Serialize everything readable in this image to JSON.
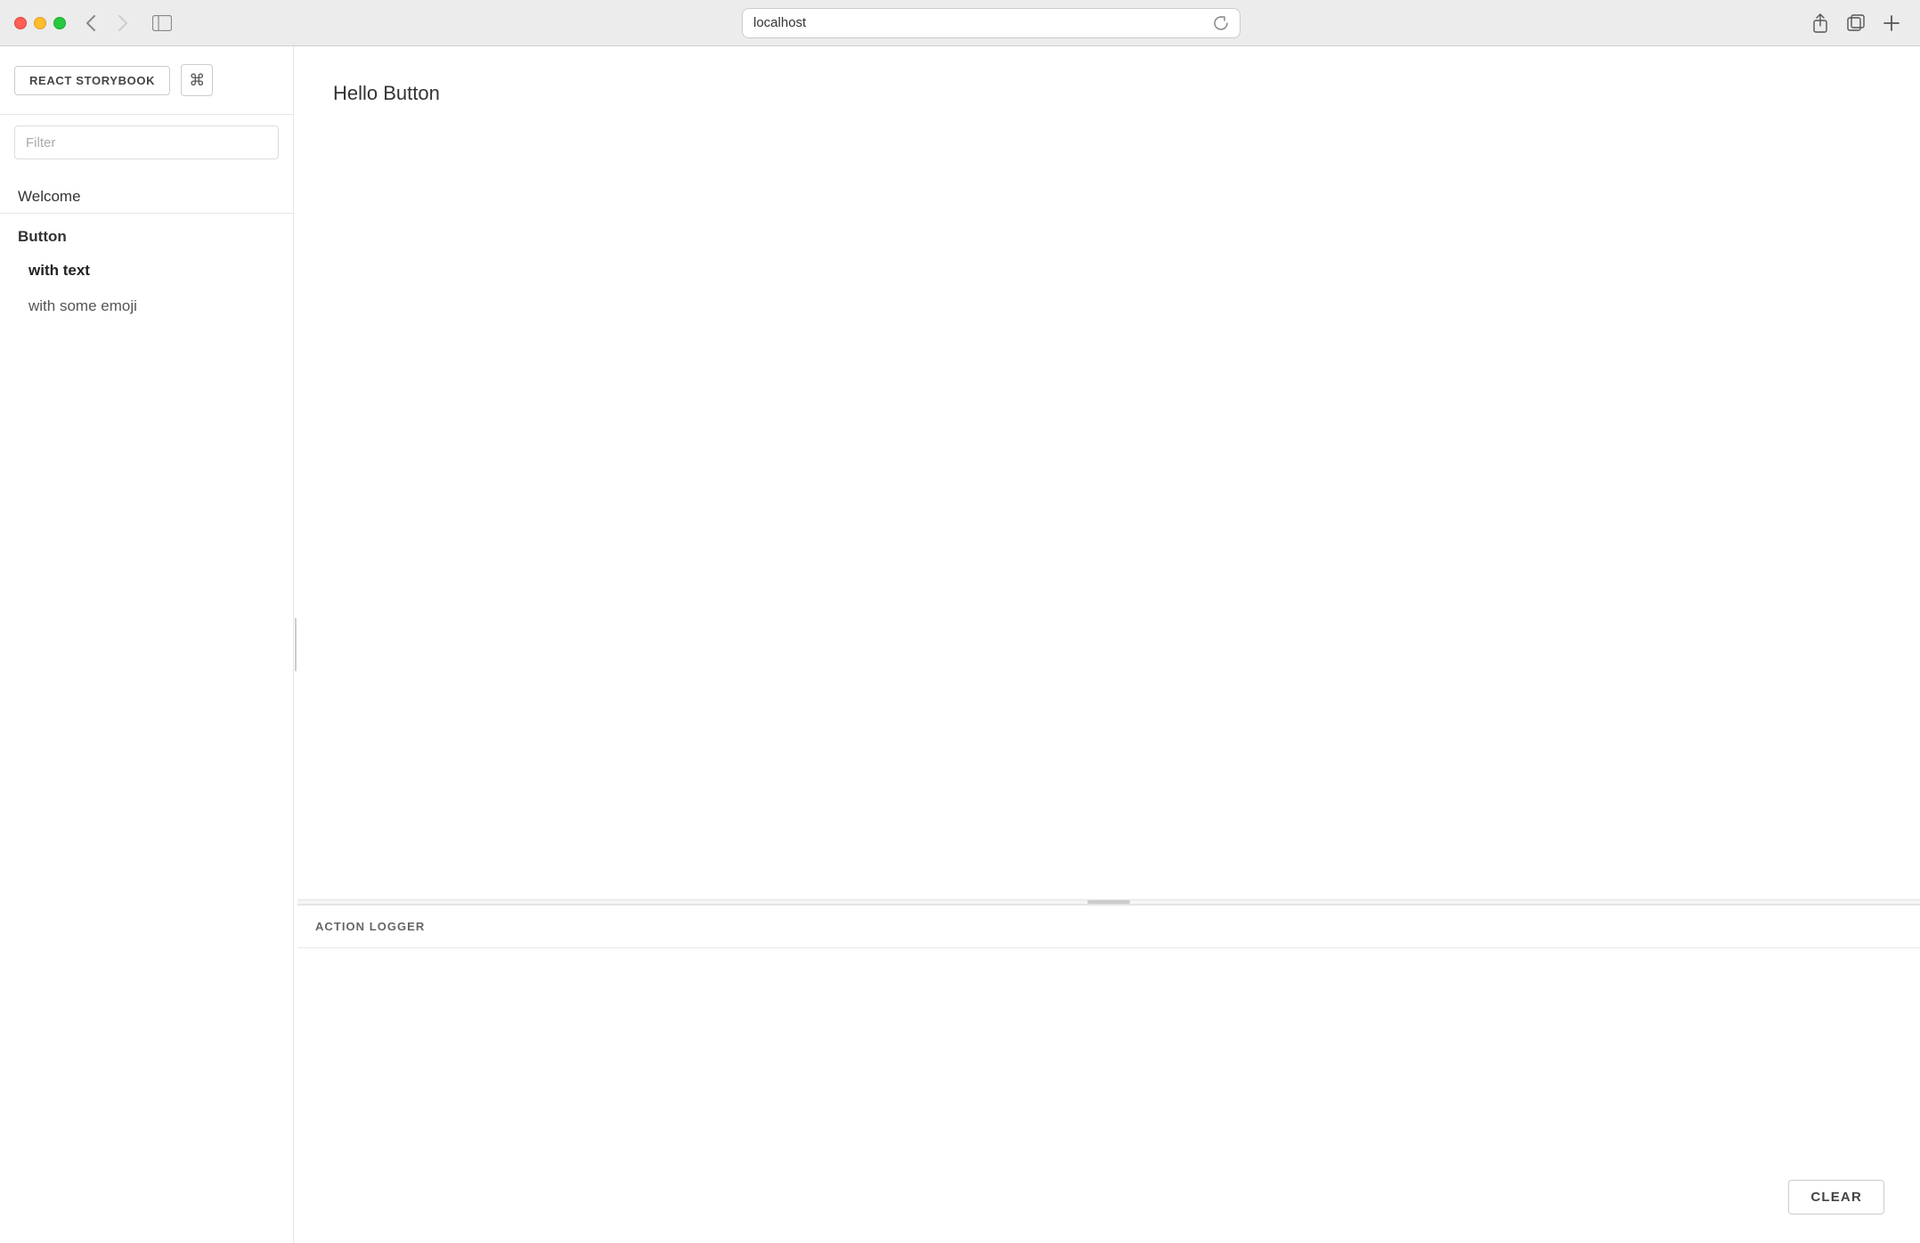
{
  "browser": {
    "url": "localhost",
    "back_disabled": false,
    "forward_disabled": false
  },
  "sidebar": {
    "storybook_label": "REACT STORYBOOK",
    "keyboard_shortcut": "⌘",
    "filter_placeholder": "Filter",
    "nav_items": [
      {
        "id": "welcome",
        "label": "Welcome",
        "type": "section",
        "active": false
      },
      {
        "id": "button",
        "label": "Button",
        "type": "section-bold",
        "active": false
      },
      {
        "id": "with-text",
        "label": "with text",
        "type": "item",
        "active": true
      },
      {
        "id": "with-some-emoji",
        "label": "with some emoji",
        "type": "item",
        "active": false
      }
    ]
  },
  "preview": {
    "title": "Hello Button"
  },
  "action_logger": {
    "title": "ACTION LOGGER",
    "clear_label": "CLEAR"
  },
  "icons": {
    "back": "‹",
    "forward": "›",
    "sidebar": "⬜",
    "reload": "↻",
    "share": "↑",
    "tabs": "⧉",
    "new_tab": "+"
  }
}
